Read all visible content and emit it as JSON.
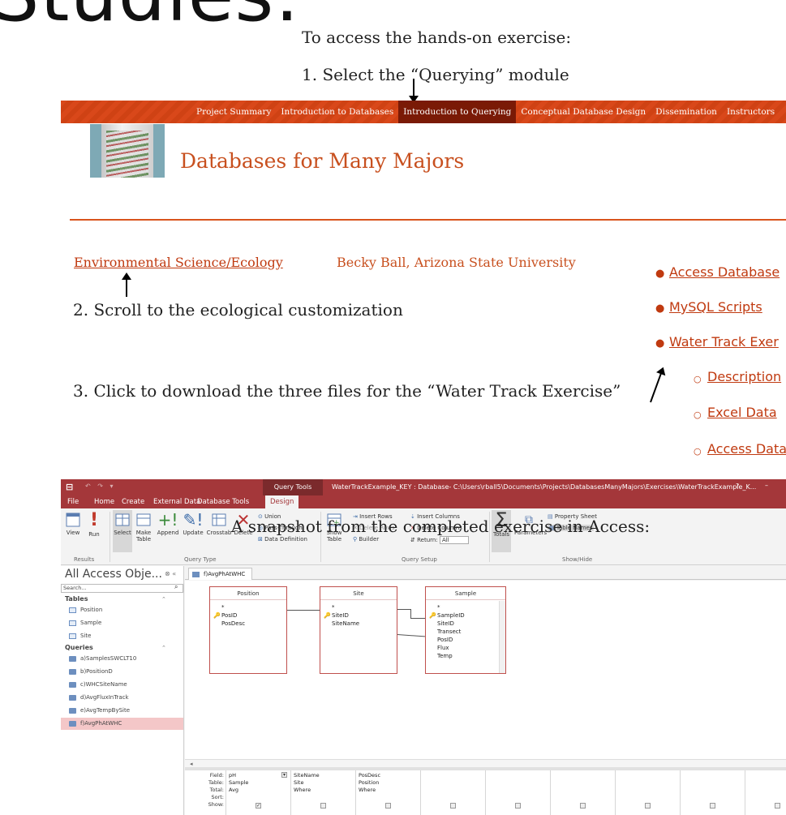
{
  "slide": {
    "title": "Studies:",
    "instruction_intro": "To access the hands-on exercise:",
    "step1": "1. Select the “Querying” module",
    "step2": "2. Scroll to the ecological customization",
    "step3": "3. Click to download the three files for the “Water Track Exercise”"
  },
  "site": {
    "nav": [
      "Project Summary",
      "Introduction to Databases",
      "Introduction to Querying",
      "Conceptual Database Design",
      "Dissemination",
      "Instructors"
    ],
    "active_nav": "Introduction to Querying",
    "title": "Databases for Many Majors",
    "customization_link": "Environmental Science/Ecology",
    "author": "Becky Ball, Arizona State University",
    "downloads": [
      "Access Database",
      "MySQL Scripts",
      "Water Track Exer"
    ],
    "sub_downloads": [
      "Description",
      "Excel Data",
      "Access Datal"
    ],
    "colors": {
      "nav_orange": "#d9481a",
      "link": "#c03a10"
    }
  },
  "access": {
    "caption": "A snapshot from the completed exercise in Access:",
    "app_icon": "access-icon",
    "query_tools": "Query Tools",
    "window_title": "WaterTrackExample_KEY : Database- C:\\Users\\rball5\\Documents\\Projects\\DatabasesManyMajors\\Exercises\\WaterTrackExample_K...",
    "help": "?",
    "minimize": "–",
    "menu": [
      "File",
      "Home",
      "Create",
      "External Data",
      "Database Tools",
      "Design"
    ],
    "ribbon": {
      "results": {
        "view": "View",
        "run": "Run",
        "label": "Results"
      },
      "query_type": {
        "select": "Select",
        "make_table": "Make Table",
        "append": "Append",
        "update": "Update",
        "crosstab": "Crosstab",
        "delete": "Delete",
        "union": "Union",
        "pass_through": "Pass-Through",
        "data_definition": "Data Definition",
        "label": "Query Type"
      },
      "query_setup": {
        "show_table": "Show Table",
        "insert_rows": "Insert Rows",
        "delete_rows": "Delete Rows",
        "builder": "Builder",
        "insert_columns": "Insert Columns",
        "delete_columns": "Delete Columns",
        "return": "Return:",
        "return_value": "All",
        "label": "Query Setup"
      },
      "show_hide": {
        "totals": "Totals",
        "parameters": "Parameters",
        "property_sheet": "Property Sheet",
        "table_names": "Table Names",
        "label": "Show/Hide"
      }
    },
    "nav_pane": {
      "header": "All Access Obje...",
      "search_placeholder": "Search...",
      "tables_label": "Tables",
      "tables": [
        "Position",
        "Sample",
        "Site"
      ],
      "queries_label": "Queries",
      "queries": [
        "a)SamplesSWCLT10",
        "b)PositionD",
        "c)WHCSiteName",
        "d)AvgFluxInTrack",
        "e)AvgTempBySite",
        "f)AvgPhAtWHC"
      ],
      "selected_query": "f)AvgPhAtWHC"
    },
    "doc_tab": "f)AvgPhAtWHC",
    "tables_in_design": [
      {
        "name": "Position",
        "fields": [
          "*",
          "PosID",
          "PosDesc"
        ],
        "keys": [
          "PosID"
        ]
      },
      {
        "name": "Site",
        "fields": [
          "*",
          "SiteID",
          "SiteName"
        ],
        "keys": [
          "SiteID"
        ]
      },
      {
        "name": "Sample",
        "fields": [
          "*",
          "SampleID",
          "SiteID",
          "Transect",
          "PosID",
          "Flux",
          "Temp"
        ],
        "keys": [
          "SampleID"
        ]
      }
    ],
    "grid": {
      "row_labels": [
        "Field:",
        "Table:",
        "Total:",
        "Sort:",
        "Show:"
      ],
      "columns": [
        {
          "field": "pH",
          "table": "Sample",
          "total": "Avg",
          "sort": "",
          "show": true
        },
        {
          "field": "SiteName",
          "table": "Site",
          "total": "Where",
          "sort": "",
          "show": false
        },
        {
          "field": "PosDesc",
          "table": "Position",
          "total": "Where",
          "sort": "",
          "show": false
        },
        {
          "field": "",
          "table": "",
          "total": "",
          "sort": "",
          "show": false
        },
        {
          "field": "",
          "table": "",
          "total": "",
          "sort": "",
          "show": false
        },
        {
          "field": "",
          "table": "",
          "total": "",
          "sort": "",
          "show": false
        },
        {
          "field": "",
          "table": "",
          "total": "",
          "sort": "",
          "show": false
        },
        {
          "field": "",
          "table": "",
          "total": "",
          "sort": "",
          "show": false
        },
        {
          "field": "",
          "table": "",
          "total": "",
          "sort": "",
          "show": false
        }
      ]
    }
  }
}
